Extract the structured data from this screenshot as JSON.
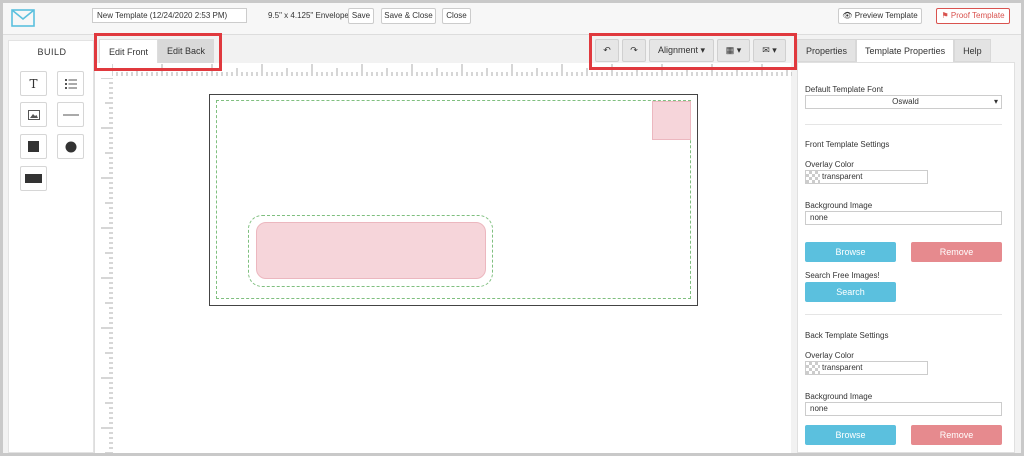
{
  "topbar": {
    "template_name": "New Template (12/24/2020 2:53 PM)",
    "size_label": "9.5\" x 4.125\" Envelope",
    "save_label": "Save",
    "save_close_label": "Save & Close",
    "close_label": "Close",
    "preview_label": "Preview Template",
    "proof_label": "Proof Template"
  },
  "build": {
    "title": "BUILD",
    "tools": [
      "text-tool",
      "list-tool",
      "image-tool",
      "line-tool",
      "square-tool",
      "circle-tool",
      "rectangle-tool"
    ]
  },
  "edit_tabs": {
    "front": "Edit Front",
    "back": "Edit Back"
  },
  "toolbar": {
    "alignment_label": "Alignment"
  },
  "right_tabs": {
    "properties": "Properties",
    "template_properties": "Template Properties",
    "help": "Help"
  },
  "panel": {
    "default_font_label": "Default Template Font",
    "default_font_value": "Oswald",
    "front_title": "Front Template Settings",
    "front_overlay_label": "Overlay Color",
    "front_overlay_value": "transparent",
    "front_bg_label": "Background Image",
    "front_bg_value": "none",
    "browse_label": "Browse",
    "remove_label": "Remove",
    "search_free_label": "Search Free Images!",
    "search_label": "Search",
    "back_title": "Back Template Settings",
    "back_overlay_label": "Overlay Color",
    "back_overlay_value": "transparent",
    "back_bg_label": "Background Image",
    "back_bg_value": "none",
    "back_browse_label": "Browse",
    "back_remove_label": "Remove"
  },
  "colors": {
    "accent_blue": "#5bc0de",
    "remove_red": "#e68a8e",
    "highlight_red": "#e0393e",
    "proof_red": "#d9534f"
  }
}
